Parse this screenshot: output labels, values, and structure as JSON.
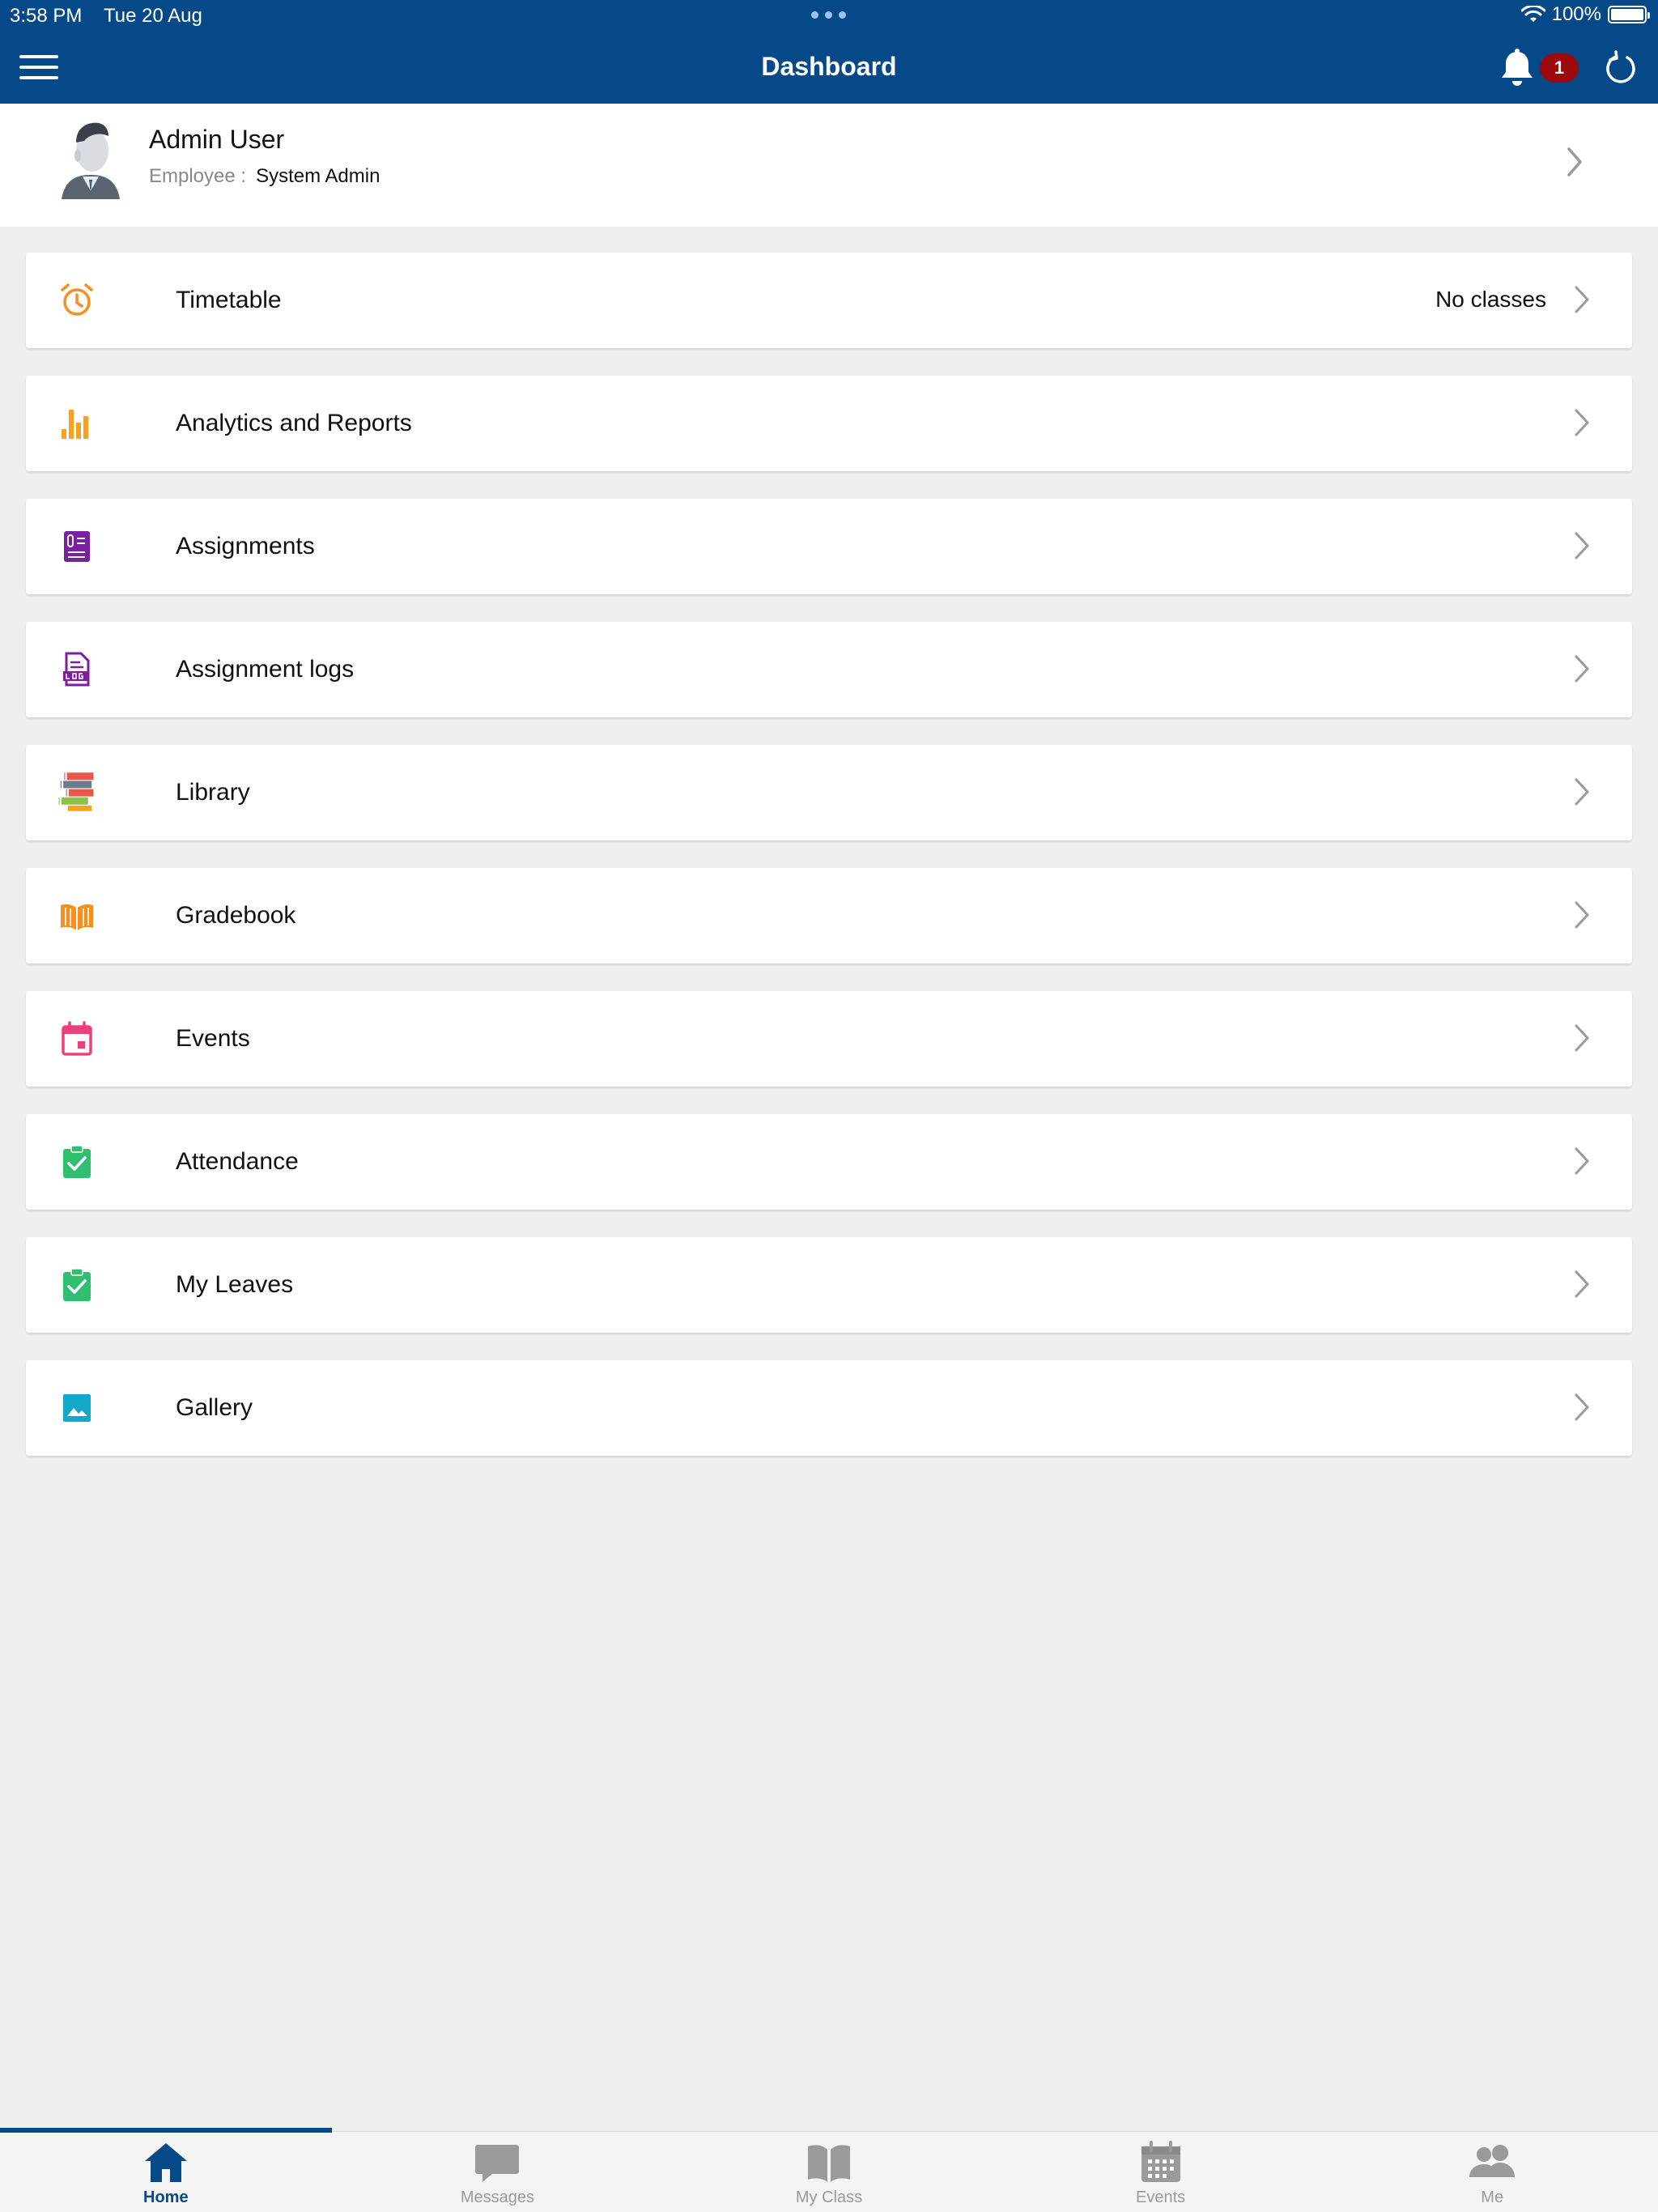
{
  "status_bar": {
    "time": "3:58 PM",
    "date": "Tue 20 Aug",
    "battery": "100%"
  },
  "nav": {
    "title": "Dashboard",
    "notification_count": "1"
  },
  "profile": {
    "name": "Admin User",
    "role_label": "Employee :",
    "role_value": "System Admin"
  },
  "menu": {
    "items": [
      {
        "label": "Timetable",
        "value": "No classes",
        "icon": "alarm-clock-icon",
        "color": "#f5901e"
      },
      {
        "label": "Analytics and Reports",
        "value": "",
        "icon": "bar-chart-icon",
        "color": "#f6a31b"
      },
      {
        "label": "Assignments",
        "value": "",
        "icon": "assignment-icon",
        "color": "#7b1fa2"
      },
      {
        "label": "Assignment logs",
        "value": "",
        "icon": "log-document-icon",
        "color": "#7b1fa2"
      },
      {
        "label": "Library",
        "value": "",
        "icon": "books-icon",
        "color": "#e9564b"
      },
      {
        "label": "Gradebook",
        "value": "",
        "icon": "open-book-icon",
        "color": "#f5901e"
      },
      {
        "label": "Events",
        "value": "",
        "icon": "calendar-icon",
        "color": "#ec407a"
      },
      {
        "label": "Attendance",
        "value": "",
        "icon": "clipboard-check-icon",
        "color": "#2fbf71"
      },
      {
        "label": "My Leaves",
        "value": "",
        "icon": "clipboard-check-icon",
        "color": "#2fbf71"
      },
      {
        "label": "Gallery",
        "value": "",
        "icon": "image-icon",
        "color": "#13a8c9"
      }
    ]
  },
  "tabbar": {
    "tabs": [
      {
        "label": "Home",
        "icon": "home-icon",
        "active": true
      },
      {
        "label": "Messages",
        "icon": "chat-bubble-icon",
        "active": false
      },
      {
        "label": "My Class",
        "icon": "book-icon",
        "active": false
      },
      {
        "label": "Events",
        "icon": "calendar-icon",
        "active": false
      },
      {
        "label": "Me",
        "icon": "people-icon",
        "active": false
      }
    ]
  },
  "colors": {
    "primary": "#064989",
    "badge": "#9c0a0e",
    "background": "#efefef",
    "inactive_tab": "#9a9a9a"
  }
}
